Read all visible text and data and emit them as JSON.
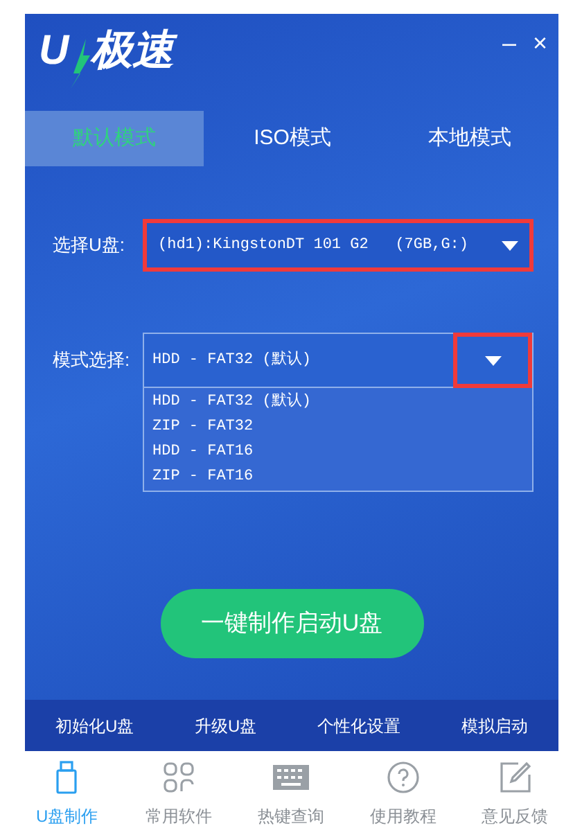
{
  "window": {
    "logo": [
      "U",
      "极速"
    ],
    "minimize": "–",
    "close": "×"
  },
  "tabs": [
    {
      "label": "默认模式",
      "selected": true
    },
    {
      "label": "ISO模式",
      "selected": false
    },
    {
      "label": "本地模式",
      "selected": false
    }
  ],
  "disk": {
    "label": "选择U盘:",
    "value": "(hd1):KingstonDT 101 G2",
    "size": "(7GB,G:)",
    "highlighted": true
  },
  "mode": {
    "label": "模式选择:",
    "value": "HDD - FAT32 (默认)",
    "expanded": true,
    "arrow_highlighted": true,
    "options": [
      "HDD - FAT32 (默认)",
      "ZIP - FAT32",
      "HDD - FAT16",
      "ZIP - FAT16"
    ]
  },
  "action_button": "一键制作启动U盘",
  "tools": [
    "初始化U盘",
    "升级U盘",
    "个性化设置",
    "模拟启动"
  ],
  "nav": [
    {
      "label": "U盘制作",
      "kind": "usb",
      "selected": true
    },
    {
      "label": "常用软件",
      "kind": "apps",
      "selected": false
    },
    {
      "label": "热键查询",
      "kind": "keyboard",
      "selected": false
    },
    {
      "label": "使用教程",
      "kind": "help",
      "selected": false
    },
    {
      "label": "意见反馈",
      "kind": "feedback",
      "selected": false
    }
  ]
}
